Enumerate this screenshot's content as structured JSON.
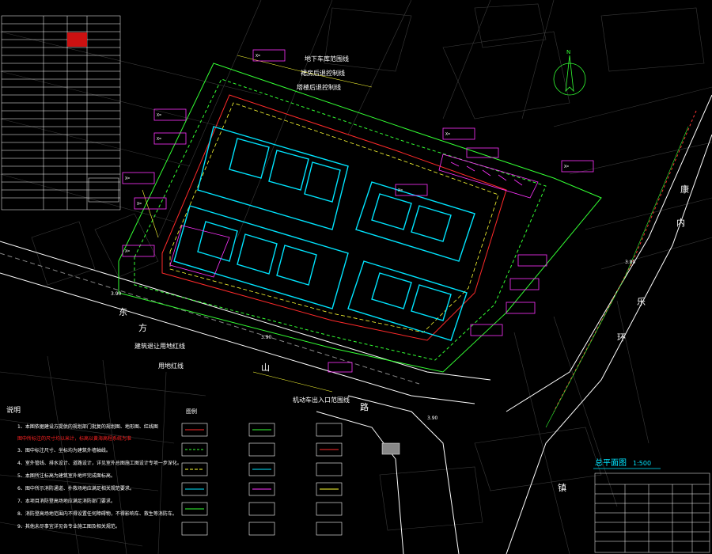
{
  "colors": {
    "background": "#000000",
    "road": "#ffffff",
    "grid": "#3a3a3a",
    "building": "#00e5ff",
    "redline": "#ff2a2a",
    "setback": "#ffff33",
    "boundary": "#33ff33",
    "tag_border": "#ff33ff",
    "notes_red": "#ff2222",
    "title_cyan": "#00e5ff"
  },
  "annotations": {
    "basement_line": "地下车库范围线",
    "podium_line": "裙房后退控制线",
    "tower_line": "塔楼后退控制线",
    "building_setback": "建筑退让用地红线",
    "land_line": "用地红线",
    "vehicle_entrance": "机动车出入口范围线"
  },
  "roads": {
    "shanshan_chars": [
      "东",
      "方",
      "山",
      "路"
    ],
    "east_road_chars": [
      "康",
      "内",
      "乐",
      "环"
    ],
    "south_road_char": "镇"
  },
  "notes": {
    "title": "说明",
    "items": [
      "1、本图依据建设方提供的规划部门批复的规划图、地形图、红线图",
      "2、图中所标注的尺寸均以米计，标高以黄海高程系统为准",
      "3、图中标注尺寸、坐标均为建筑外墙轴线。",
      "4、室外管线、排水设计、道路设计，详见室外总图施工图设计专项一步深化。",
      "5、本图所注标高为建筑室外地坪完成面标高。",
      "6、图中所示消防通道、扑救场地应满足相关规范要求。",
      "7、本项目消防登高场地应满足消防部门要求。",
      "8、消防登高场地范围内不得设置任何障碍物，不得影响车、救生等消防车。",
      "9、其他未尽事宜详见各专业施工图及相关规范。"
    ],
    "red_note": "图中所标注的尺寸均以米计，标高以黄海高程系统为准"
  },
  "legend": {
    "title": "图例"
  },
  "plan_title": {
    "label": "总平面图",
    "scale": "1:500"
  },
  "elevations": [
    "3.90",
    "3.90",
    "3.90",
    "3.80"
  ],
  "north_arrow": "N"
}
